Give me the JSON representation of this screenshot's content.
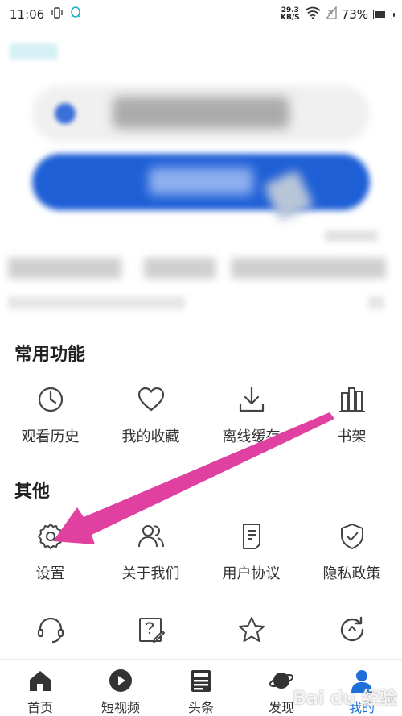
{
  "status_bar": {
    "time": "11:06",
    "net_speed_value": "29.3",
    "net_speed_unit": "KB/S",
    "battery": "73%",
    "battery_level": 0.73
  },
  "common_functions": {
    "title": "常用功能",
    "items": [
      {
        "label": "观看历史",
        "icon": "clock-icon"
      },
      {
        "label": "我的收藏",
        "icon": "heart-icon"
      },
      {
        "label": "离线缓存",
        "icon": "download-icon"
      },
      {
        "label": "书架",
        "icon": "bookshelf-icon"
      }
    ]
  },
  "others": {
    "title": "其他",
    "items": [
      {
        "label": "设置",
        "icon": "gear-icon"
      },
      {
        "label": "关于我们",
        "icon": "users-icon"
      },
      {
        "label": "用户协议",
        "icon": "document-icon"
      },
      {
        "label": "隐私政策",
        "icon": "shield-icon"
      }
    ],
    "extra_items": [
      {
        "icon": "headset-icon"
      },
      {
        "icon": "feedback-icon"
      },
      {
        "icon": "star-icon"
      },
      {
        "icon": "refresh-icon"
      }
    ]
  },
  "bottom_nav": {
    "items": [
      {
        "label": "首页",
        "icon": "home-icon"
      },
      {
        "label": "短视频",
        "icon": "play-icon"
      },
      {
        "label": "头条",
        "icon": "news-icon"
      },
      {
        "label": "发现",
        "icon": "planet-icon"
      },
      {
        "label": "我的",
        "icon": "user-icon"
      }
    ],
    "active_index": 4,
    "active_color": "#1e6fd9"
  },
  "annotation": {
    "arrow_color": "#e040a0"
  },
  "watermark": "Bai du 经验"
}
